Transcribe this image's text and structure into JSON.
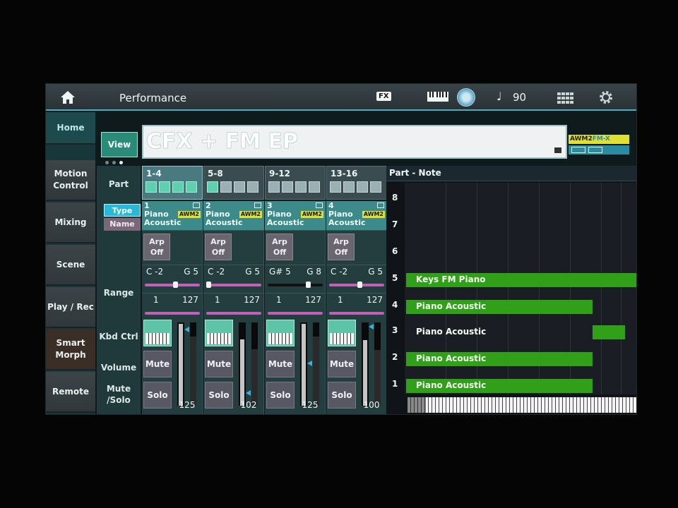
{
  "header": {
    "title": "Performance",
    "fx_label": "FX",
    "tempo": "90",
    "note_symbol": "♩"
  },
  "nav": {
    "items": [
      {
        "label": "Home",
        "active": true
      },
      {
        "label": "Motion Control"
      },
      {
        "label": "Mixing"
      },
      {
        "label": "Scene"
      },
      {
        "label": "Play / Rec"
      },
      {
        "label": "Smart Morph"
      },
      {
        "label": "Remote"
      }
    ]
  },
  "view": {
    "view_label": "View",
    "performance_name": "CFX + FM EP",
    "awm_label": "AWM2",
    "fmx_label": "FM-X"
  },
  "rows": {
    "part": "Part",
    "type": "Type",
    "name": "Name",
    "range": "Range",
    "kbd_ctrl": "Kbd Ctrl",
    "volume": "Volume",
    "mute_solo": "Mute /Solo"
  },
  "groups": [
    "1-4",
    "5-8",
    "9-12",
    "13-16"
  ],
  "parts": [
    {
      "num": "1",
      "category": "Piano",
      "sub": "Acoustic",
      "engine": "AWM2",
      "arp": "Arp Off",
      "note_lo": "C -2",
      "note_hi": "G 5",
      "vel_lo": "1",
      "vel_hi": "127",
      "mute": "Mute",
      "solo": "Solo",
      "volume": "125",
      "volume_level": 0.98
    },
    {
      "num": "2",
      "category": "Piano",
      "sub": "Acoustic",
      "engine": "AWM2",
      "arp": "Arp Off",
      "note_lo": "C -2",
      "note_hi": "G 5",
      "vel_lo": "1",
      "vel_hi": "127",
      "mute": "Mute",
      "solo": "Solo",
      "volume": "102",
      "volume_level": 0.8
    },
    {
      "num": "3",
      "category": "Piano",
      "sub": "Acoustic",
      "engine": "AWM2",
      "arp": "Arp Off",
      "note_lo": "G# 5",
      "note_hi": "G 8",
      "vel_lo": "1",
      "vel_hi": "127",
      "mute": "Mute",
      "solo": "Solo",
      "volume": "125",
      "volume_level": 0.98
    },
    {
      "num": "4",
      "category": "Piano",
      "sub": "Acoustic",
      "engine": "AWM2",
      "arp": "Arp Off",
      "note_lo": "C -2",
      "note_hi": "G 5",
      "vel_lo": "1",
      "vel_hi": "127",
      "mute": "Mute",
      "solo": "Solo",
      "volume": "100",
      "volume_level": 0.79
    }
  ],
  "note_panel": {
    "title": "Part - Note",
    "rows": [
      {
        "part": "8",
        "label": ""
      },
      {
        "part": "7",
        "label": ""
      },
      {
        "part": "6",
        "label": ""
      },
      {
        "part": "5",
        "label": "Keys FM Piano"
      },
      {
        "part": "4",
        "label": "Piano Acoustic"
      },
      {
        "part": "3",
        "label": "Piano Acoustic"
      },
      {
        "part": "2",
        "label": "Piano Acoustic"
      },
      {
        "part": "1",
        "label": "Piano Acoustic"
      }
    ]
  },
  "colors": {
    "accent": "#4ab0c8",
    "note_bar": "#2fa018",
    "awm_badge": "#e0e030",
    "range_bar": "#c060b8"
  }
}
